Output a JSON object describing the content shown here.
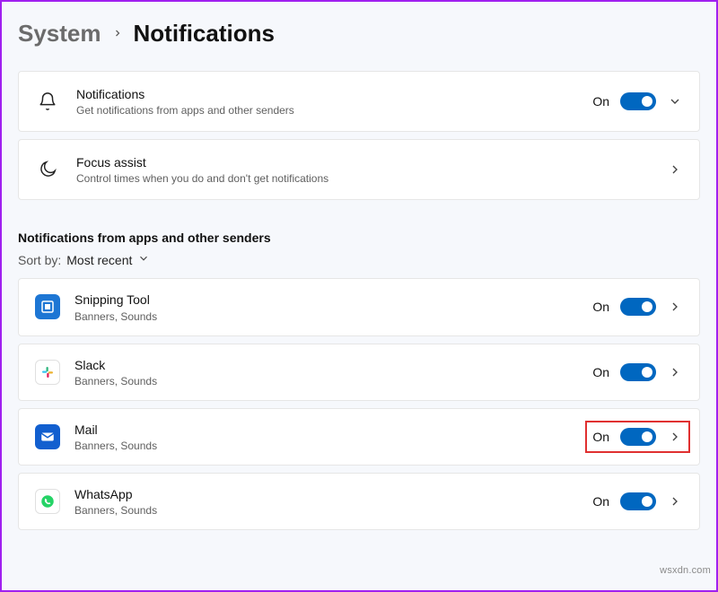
{
  "breadcrumb": {
    "parent": "System",
    "current": "Notifications"
  },
  "top_rows": [
    {
      "key": "notifications",
      "icon": "bell-icon",
      "title": "Notifications",
      "subtitle": "Get notifications from apps and other senders",
      "state_label": "On",
      "has_toggle": true,
      "expand_dir": "down"
    },
    {
      "key": "focus-assist",
      "icon": "moon-icon",
      "title": "Focus assist",
      "subtitle": "Control times when you do and don't get notifications",
      "has_toggle": false,
      "expand_dir": "right"
    }
  ],
  "apps_section": {
    "heading": "Notifications from apps and other senders",
    "sort_label": "Sort by:",
    "sort_value": "Most recent"
  },
  "apps": [
    {
      "key": "snipping-tool",
      "name": "Snipping Tool",
      "detail": "Banners, Sounds",
      "state_label": "On",
      "icon_bg": "#1d76d4",
      "highlighted": false
    },
    {
      "key": "slack",
      "name": "Slack",
      "detail": "Banners, Sounds",
      "state_label": "On",
      "icon_bg": "#ffffff",
      "highlighted": false
    },
    {
      "key": "mail",
      "name": "Mail",
      "detail": "Banners, Sounds",
      "state_label": "On",
      "icon_bg": "#125fcf",
      "highlighted": true
    },
    {
      "key": "whatsapp",
      "name": "WhatsApp",
      "detail": "Banners, Sounds",
      "state_label": "On",
      "icon_bg": "#25d366",
      "highlighted": false
    }
  ],
  "watermark": "wsxdn.com"
}
